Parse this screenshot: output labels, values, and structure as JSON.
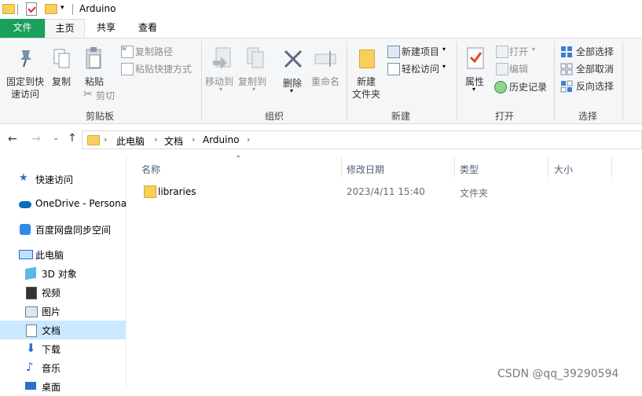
{
  "titlebar": {
    "title": "Arduino"
  },
  "tabs": {
    "file": "文件",
    "home": "主页",
    "share": "共享",
    "view": "查看"
  },
  "ribbon": {
    "pin": "固定到快",
    "pin2": "速访问",
    "copy": "复制",
    "paste": "粘贴",
    "copy_path": "复制路径",
    "paste_shortcut": "粘贴快捷方式",
    "cut": "剪切",
    "group_clipboard": "剪贴板",
    "move_to": "移动到",
    "copy_to": "复制到",
    "delete": "删除",
    "rename": "重命名",
    "group_organize": "组织",
    "new_folder": "新建",
    "new_folder2": "文件夹",
    "new_item": "新建项目",
    "easy_access": "轻松访问",
    "group_new": "新建",
    "properties": "属性",
    "open": "打开",
    "edit": "编辑",
    "history": "历史记录",
    "group_open": "打开",
    "select_all": "全部选择",
    "select_none": "全部取消",
    "invert_selection": "反向选择",
    "group_select": "选择"
  },
  "address": {
    "crumbs": [
      "此电脑",
      "文档",
      "Arduino"
    ]
  },
  "sidebar": {
    "items": [
      {
        "label": "快速访问"
      },
      {
        "label": "OneDrive - Persona"
      },
      {
        "label": "百度网盘同步空间"
      },
      {
        "label": "此电脑"
      },
      {
        "label": "3D 对象"
      },
      {
        "label": "视频"
      },
      {
        "label": "图片"
      },
      {
        "label": "文档"
      },
      {
        "label": "下载"
      },
      {
        "label": "音乐"
      },
      {
        "label": "桌面"
      }
    ]
  },
  "columns": {
    "name": "名称",
    "modified": "修改日期",
    "type": "类型",
    "size": "大小"
  },
  "files": [
    {
      "name": "libraries",
      "modified": "2023/4/11 15:40",
      "type": "文件夹"
    }
  ],
  "watermark": "CSDN @qq_39290594"
}
